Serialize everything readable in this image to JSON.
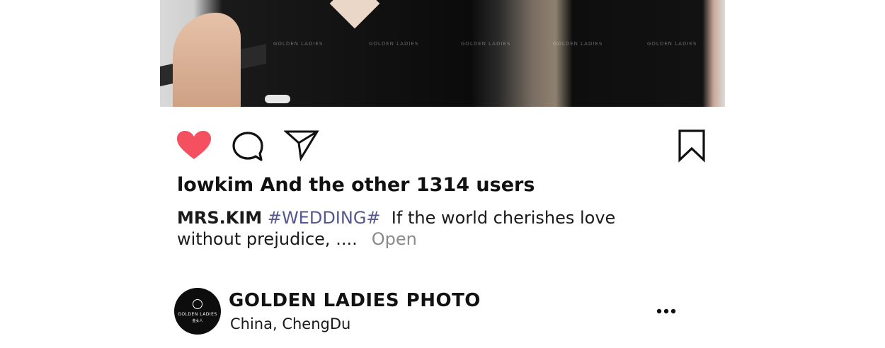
{
  "photo": {
    "watermark_text": "GOLDEN LADIES"
  },
  "actions": {
    "like_icon": "heart-filled-icon",
    "comment_icon": "speech-bubble-icon",
    "share_icon": "paper-plane-icon",
    "bookmark_icon": "bookmark-icon",
    "like_color": "#f4505f"
  },
  "post": {
    "likes_text": "lowkim And the other 1314 users",
    "author": "MRS.KIM",
    "hashtag": "#WEDDING#",
    "caption_text": "If the world cherishes love without prejudice, ....",
    "more_label": "Open"
  },
  "profile": {
    "avatar_brand": "GOLDEN LADIES",
    "avatar_sub": "金女人",
    "name": "GOLDEN LADIES PHOTO",
    "location": "China,  ChengDu",
    "menu_icon": "more-dots-icon"
  }
}
